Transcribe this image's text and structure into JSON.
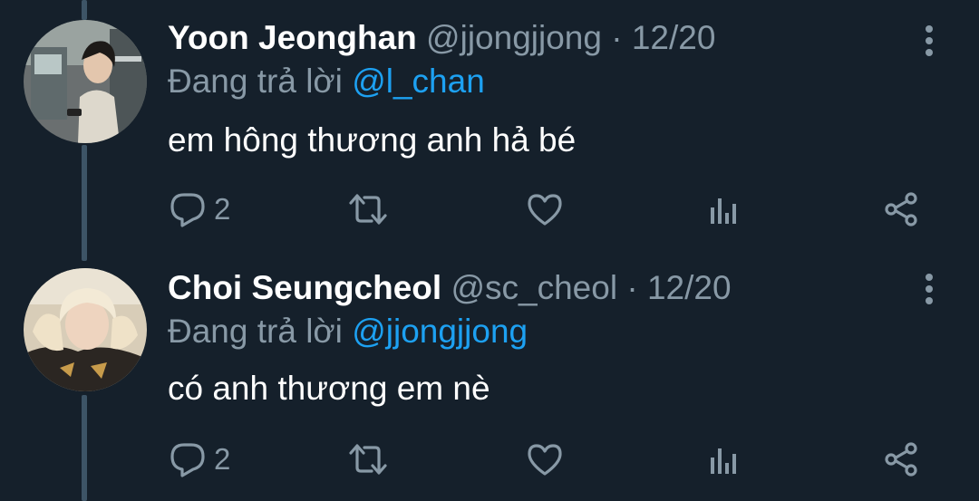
{
  "tweets": [
    {
      "display_name": "Yoon Jeonghan",
      "handle": "@jjongjjong",
      "separator": "·",
      "date": "12/20",
      "reply_prefix": "Đang trả lời",
      "reply_to": "@l_chan",
      "text": "em hông thương anh hả bé",
      "reply_count": "2",
      "avatar_icon": "avatar-photo"
    },
    {
      "display_name": "Choi Seungcheol",
      "handle": "@sc_cheol",
      "separator": "·",
      "date": "12/20",
      "reply_prefix": "Đang trả lời",
      "reply_to": "@jjongjjong",
      "text": "có anh thương em nè",
      "reply_count": "2",
      "avatar_icon": "avatar-photo"
    }
  ],
  "icons": {
    "reply": "reply-icon",
    "retweet": "retweet-icon",
    "like": "heart-icon",
    "analytics": "analytics-icon",
    "share": "share-icon",
    "more": "more-vertical-icon"
  },
  "colors": {
    "background": "#15202b",
    "primary_text": "#ffffff",
    "secondary_text": "#8899a6",
    "accent": "#1da1f2",
    "thread_line": "#3d5466"
  }
}
